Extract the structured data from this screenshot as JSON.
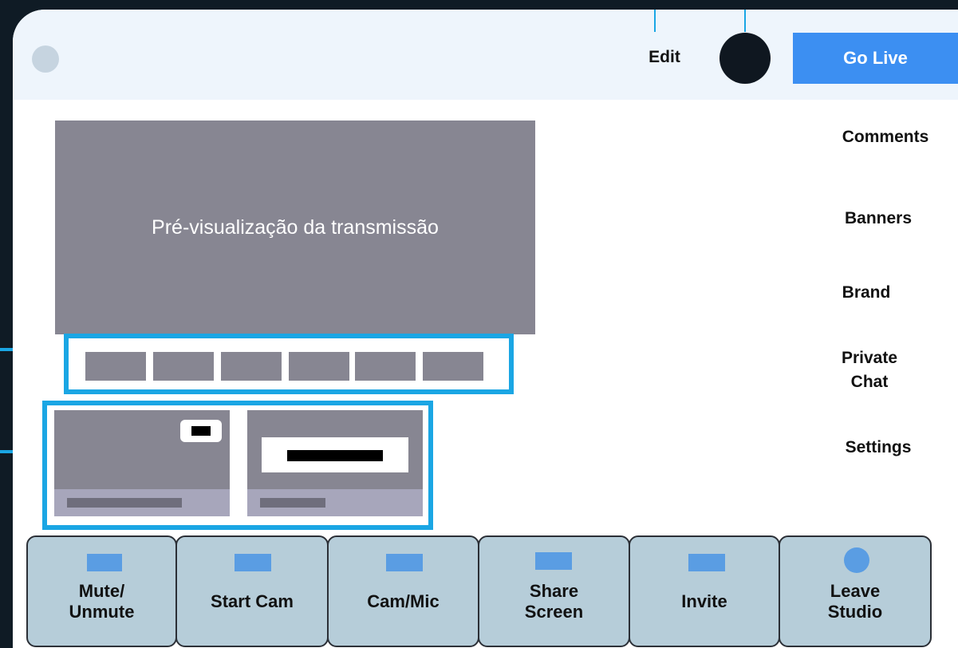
{
  "header": {
    "edit_label": "Edit",
    "go_live_label": "Go Live"
  },
  "preview": {
    "label": "Pré-visualização da transmissão"
  },
  "sidebar": {
    "items": [
      {
        "label": "Comments"
      },
      {
        "label": "Banners"
      },
      {
        "label": "Brand"
      },
      {
        "label": "Private\nChat"
      },
      {
        "label": "Settings"
      }
    ]
  },
  "dock": {
    "buttons": [
      {
        "label": "Mute/\nUnmute",
        "icon": "mic-icon"
      },
      {
        "label": "Start Cam",
        "icon": "camera-icon"
      },
      {
        "label": "Cam/Mic",
        "icon": "device-settings-icon"
      },
      {
        "label": "Share\nScreen",
        "icon": "screen-share-icon"
      },
      {
        "label": "Invite",
        "icon": "invite-icon"
      },
      {
        "label": "Leave\nStudio",
        "icon": "leave-icon"
      }
    ]
  },
  "colors": {
    "accent": "#1aa6e4",
    "go_live": "#3c8ff2",
    "header_bg": "#eef5fc",
    "placeholder_gray": "#878692",
    "dock_bg": "#b6cdd9"
  }
}
